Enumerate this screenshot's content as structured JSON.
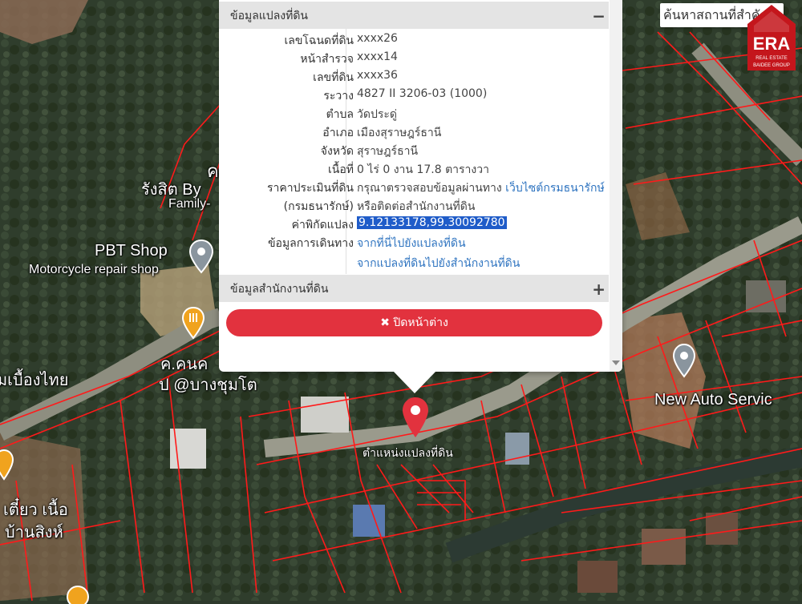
{
  "map": {
    "poi_labels": [
      {
        "id": "pbt",
        "text": "PBT Shop"
      },
      {
        "id": "moto",
        "text": "Motorcycle repair shop"
      },
      {
        "id": "rangsit",
        "text": "รังสิต By"
      },
      {
        "id": "family",
        "text": "Family-"
      },
      {
        "id": "kuay",
        "text": "ก๋วย"
      },
      {
        "id": "mueang_thai",
        "text": "มเบื้องไทย"
      },
      {
        "id": "khon",
        "text": "ค.คนค"
      },
      {
        "id": "pi",
        "text": "ป @บางชุมโต"
      },
      {
        "id": "auto",
        "text": "New Auto Servic"
      },
      {
        "id": "tiew",
        "text": "เตี๋ยว เนื้อ"
      },
      {
        "id": "baan",
        "text": "บ้านสิงห์"
      }
    ],
    "marker_label": "ตำแหน่งแปลงที่ดิน",
    "accent_color": "#e2323e",
    "parcel_line_color": "#ff1a1a"
  },
  "search": {
    "placeholder": "ค้นหาสถานที่สำคัญ"
  },
  "logo": {
    "name": "ERA",
    "sub": "REAL ESTATE",
    "tag": "BAIDEE GROUP"
  },
  "popup": {
    "land_section_title": "ข้อมูลแปลงที่ดิน",
    "land_section_toggle": "−",
    "rows": [
      {
        "label": "เลขโฉนดที่ดิน",
        "value": "xxxx26"
      },
      {
        "label": "หน้าสำรวจ",
        "value": "xxxx14"
      },
      {
        "label": "เลขที่ดิน",
        "value": "xxxx36"
      },
      {
        "label": "ระวาง",
        "value": "4827 II 3206-03 (1000)"
      },
      {
        "label": "ตำบล",
        "value": "วัดประดู่"
      },
      {
        "label": "อำเภอ",
        "value": "เมืองสุราษฎร์ธานี"
      },
      {
        "label": "จังหวัด",
        "value": "สุราษฎร์ธานี"
      },
      {
        "label": "เนื้อที่",
        "value": "0 ไร่ 0 งาน 17.8 ตารางวา"
      }
    ],
    "price_label": "ราคาประเมินที่ดิน",
    "price_text": "กรุณาตรวจสอบข้อมูลผ่านทาง",
    "price_link": "เว็บไซต์กรมธนารักษ์",
    "price_label2": "(กรมธนารักษ์)",
    "price_text2": "หรือติดต่อสำนักงานที่ดิน",
    "coord_label": "ค่าพิกัดแปลง",
    "coord_value": "9.12133178,99.30092780",
    "travel_label": "ข้อมูลการเดินทาง",
    "travel_link1": "จากที่นี่ไปยังแปลงที่ดิน",
    "travel_link2": "จากแปลงที่ดินไปยังสำนักงานที่ดิน",
    "office_section_title": "ข้อมูลสำนักงานที่ดิน",
    "office_section_toggle": "+",
    "close_icon": "✖",
    "close_label": "ปิดหน้าต่าง"
  }
}
